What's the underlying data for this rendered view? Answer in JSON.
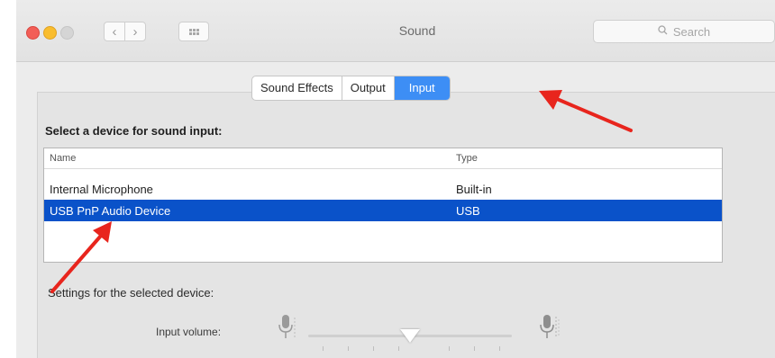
{
  "window": {
    "title": "Sound"
  },
  "search": {
    "placeholder": "Search"
  },
  "tabs": [
    {
      "label": "Sound Effects"
    },
    {
      "label": "Output"
    },
    {
      "label": "Input"
    }
  ],
  "input": {
    "heading": "Select a device for sound input:",
    "columns": [
      "Name",
      "Type"
    ],
    "devices": [
      {
        "name": "Internal Microphone",
        "type": "Built-in"
      },
      {
        "name": "USB PnP Audio Device",
        "type": "USB"
      }
    ],
    "settings_label": "Settings for the selected device:",
    "volume_label": "Input volume:",
    "volume_level": 0.5
  },
  "colors": {
    "accent": "#3d8ef5",
    "selection": "#0a52c9",
    "annotation_arrow": "#e8251d"
  },
  "icons": [
    "close-light",
    "minimize-light",
    "zoom-light",
    "chevron-left",
    "chevron-right",
    "grid",
    "search",
    "microphone"
  ]
}
